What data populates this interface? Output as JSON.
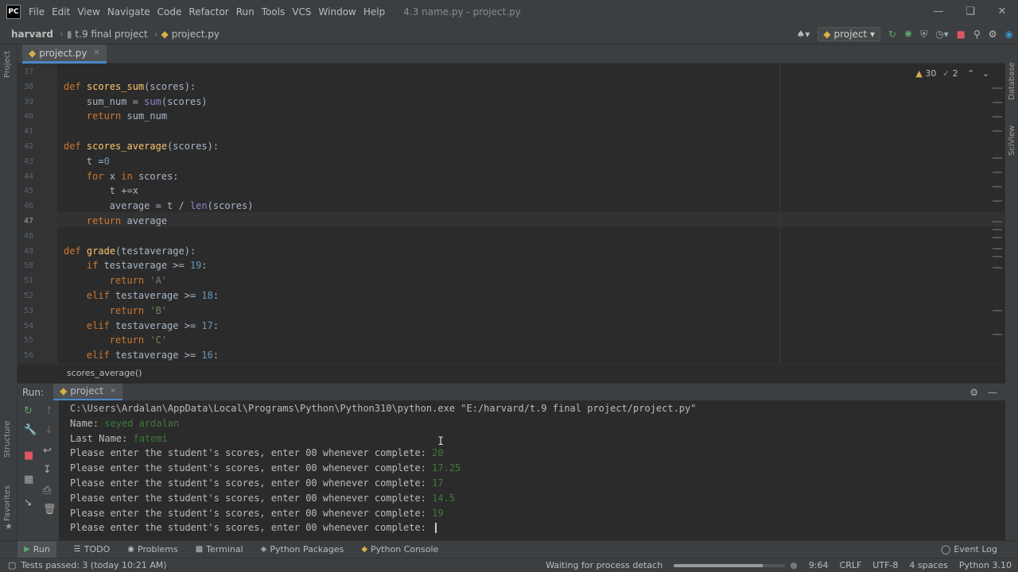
{
  "app": {
    "logo": "PC",
    "menu": [
      "File",
      "Edit",
      "View",
      "Navigate",
      "Code",
      "Refactor",
      "Run",
      "Tools",
      "VCS",
      "Window",
      "Help"
    ],
    "title": "4.3 name.py - project.py"
  },
  "nav": {
    "breadcrumb": [
      "harvard",
      "t.9 final project",
      "project.py"
    ],
    "run_config": "project"
  },
  "editor": {
    "tab": "project.py",
    "inspection": {
      "warnings": "30",
      "weak_warnings": "2"
    },
    "current_line": "47",
    "lines": [
      {
        "n": "37",
        "text": ""
      },
      {
        "n": "38",
        "text": "def scores_sum(scores):"
      },
      {
        "n": "39",
        "text": "    sum_num = sum(scores)"
      },
      {
        "n": "40",
        "text": "    return sum_num"
      },
      {
        "n": "41",
        "text": ""
      },
      {
        "n": "42",
        "text": "def scores_average(scores):"
      },
      {
        "n": "43",
        "text": "    t =0"
      },
      {
        "n": "44",
        "text": "    for x in scores:"
      },
      {
        "n": "45",
        "text": "        t +=x"
      },
      {
        "n": "46",
        "text": "        average = t / len(scores)"
      },
      {
        "n": "47",
        "text": "    return average"
      },
      {
        "n": "48",
        "text": ""
      },
      {
        "n": "49",
        "text": "def grade(testaverage):"
      },
      {
        "n": "50",
        "text": "    if testaverage >= 19:"
      },
      {
        "n": "51",
        "text": "        return 'A'"
      },
      {
        "n": "52",
        "text": "    elif testaverage >= 18:"
      },
      {
        "n": "53",
        "text": "        return 'B'"
      },
      {
        "n": "54",
        "text": "    elif testaverage >= 17:"
      },
      {
        "n": "55",
        "text": "        return 'C'"
      },
      {
        "n": "56",
        "text": "    elif testaverage >= 16:"
      }
    ],
    "breadcrumb": "scores_average()"
  },
  "run": {
    "label": "Run:",
    "tab": "project",
    "console": [
      {
        "text": "C:\\Users\\Ardalan\\AppData\\Local\\Programs\\Python\\Python310\\python.exe \"E:/harvard/t.9 final project/project.py\"",
        "input": ""
      },
      {
        "text": "Name: ",
        "input": "seyed ardalan"
      },
      {
        "text": "Last Name: ",
        "input": "fatemi"
      },
      {
        "text": "Please enter the student's scores, enter 00 whenever complete: ",
        "input": "20"
      },
      {
        "text": "Please enter the student's scores, enter 00 whenever complete: ",
        "input": "17.25"
      },
      {
        "text": "Please enter the student's scores, enter 00 whenever complete: ",
        "input": "17"
      },
      {
        "text": "Please enter the student's scores, enter 00 whenever complete: ",
        "input": "14.5"
      },
      {
        "text": "Please enter the student's scores, enter 00 whenever complete: ",
        "input": "19"
      },
      {
        "text": "Please enter the student's scores, enter 00 whenever complete: ",
        "input": ""
      }
    ]
  },
  "toolwindows": [
    "Run",
    "TODO",
    "Problems",
    "Terminal",
    "Python Packages",
    "Python Console"
  ],
  "event_log": "Event Log",
  "sidebars": {
    "left_top": "Project",
    "left_mid": "Structure",
    "left_bot": "Favorites",
    "right_top": "Database",
    "right_mid": "SciView"
  },
  "status": {
    "tests": "Tests passed: 3 (today 10:21 AM)",
    "process": "Waiting for process detach",
    "progress": 0.8,
    "position": "9:64",
    "line_sep": "CRLF",
    "encoding": "UTF-8",
    "indent": "4 spaces",
    "interpreter": "Python 3.10"
  }
}
